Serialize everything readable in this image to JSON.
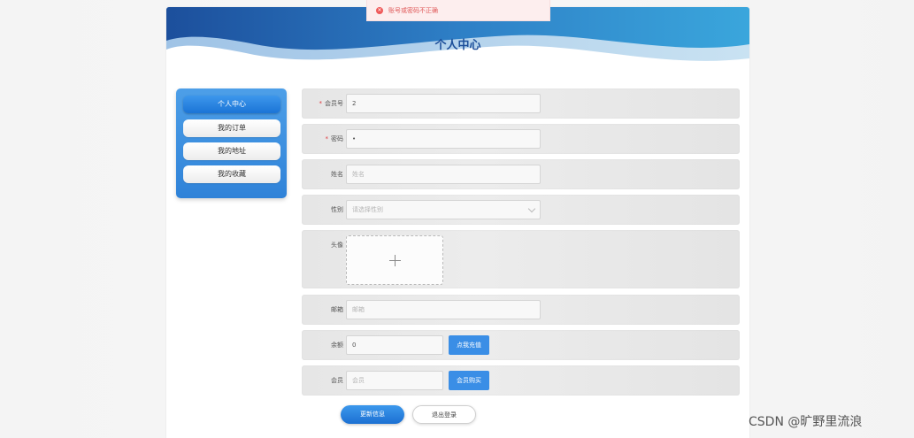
{
  "toast": {
    "message": "账号或密码不正确"
  },
  "header": {
    "title": "个人中心"
  },
  "sidebar": {
    "items": [
      {
        "label": "个人中心",
        "active": true
      },
      {
        "label": "我的订单",
        "active": false
      },
      {
        "label": "我的地址",
        "active": false
      },
      {
        "label": "我的收藏",
        "active": false
      }
    ]
  },
  "form": {
    "member_no": {
      "label": "会员号",
      "value": "2"
    },
    "password": {
      "label": "密码",
      "value": "•"
    },
    "name": {
      "label": "姓名",
      "placeholder": "姓名"
    },
    "gender": {
      "label": "性别",
      "placeholder": "请选择性别"
    },
    "avatar": {
      "label": "头像"
    },
    "email": {
      "label": "邮箱",
      "placeholder": "邮箱"
    },
    "balance": {
      "label": "余额",
      "value": "0",
      "button": "点我充值"
    },
    "member": {
      "label": "会员",
      "placeholder": "会员",
      "button": "会员购买"
    }
  },
  "actions": {
    "update": "更新信息",
    "logout": "退出登录"
  },
  "watermark": "CSDN @旷野里流浪",
  "colors": {
    "accent": "#3a8ee6",
    "title": "#1d4f9a",
    "error": "#ef5a5a"
  }
}
